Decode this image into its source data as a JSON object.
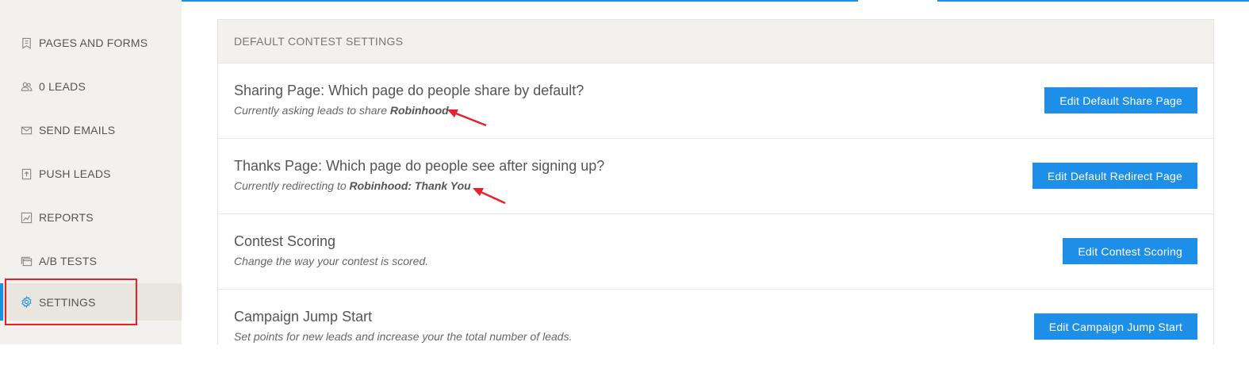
{
  "sidebar": {
    "items": [
      {
        "label": "PAGES AND FORMS",
        "icon": "page-icon"
      },
      {
        "label": "0 LEADS",
        "icon": "users-icon"
      },
      {
        "label": "SEND EMAILS",
        "icon": "envelope-icon"
      },
      {
        "label": "PUSH LEADS",
        "icon": "upload-icon"
      },
      {
        "label": "REPORTS",
        "icon": "chart-icon"
      },
      {
        "label": "A/B TESTS",
        "icon": "window-icon"
      },
      {
        "label": "SETTINGS",
        "icon": "gear-icon",
        "active": true
      }
    ],
    "accent_color": "#1e8fe1"
  },
  "panel": {
    "header": "DEFAULT CONTEST SETTINGS",
    "rows": [
      {
        "title": "Sharing Page: Which page do people share by default?",
        "sub_prefix": "Currently asking leads to share ",
        "sub_bold": "Robinhood",
        "button": "Edit Default Share Page"
      },
      {
        "title": "Thanks Page: Which page do people see after signing up?",
        "sub_prefix": "Currently redirecting to ",
        "sub_bold": "Robinhood: Thank You",
        "button": "Edit Default Redirect Page"
      },
      {
        "title": "Contest Scoring",
        "sub_prefix": "Change the way your contest is scored.",
        "sub_bold": "",
        "button": "Edit Contest Scoring"
      },
      {
        "title": "Campaign Jump Start",
        "sub_prefix": "Set points for new leads and increase your the total number of leads.",
        "sub_bold": "",
        "button": "Edit Campaign Jump Start"
      }
    ]
  },
  "colors": {
    "button": "#1e8fe8",
    "annotation": "#e8202a"
  }
}
